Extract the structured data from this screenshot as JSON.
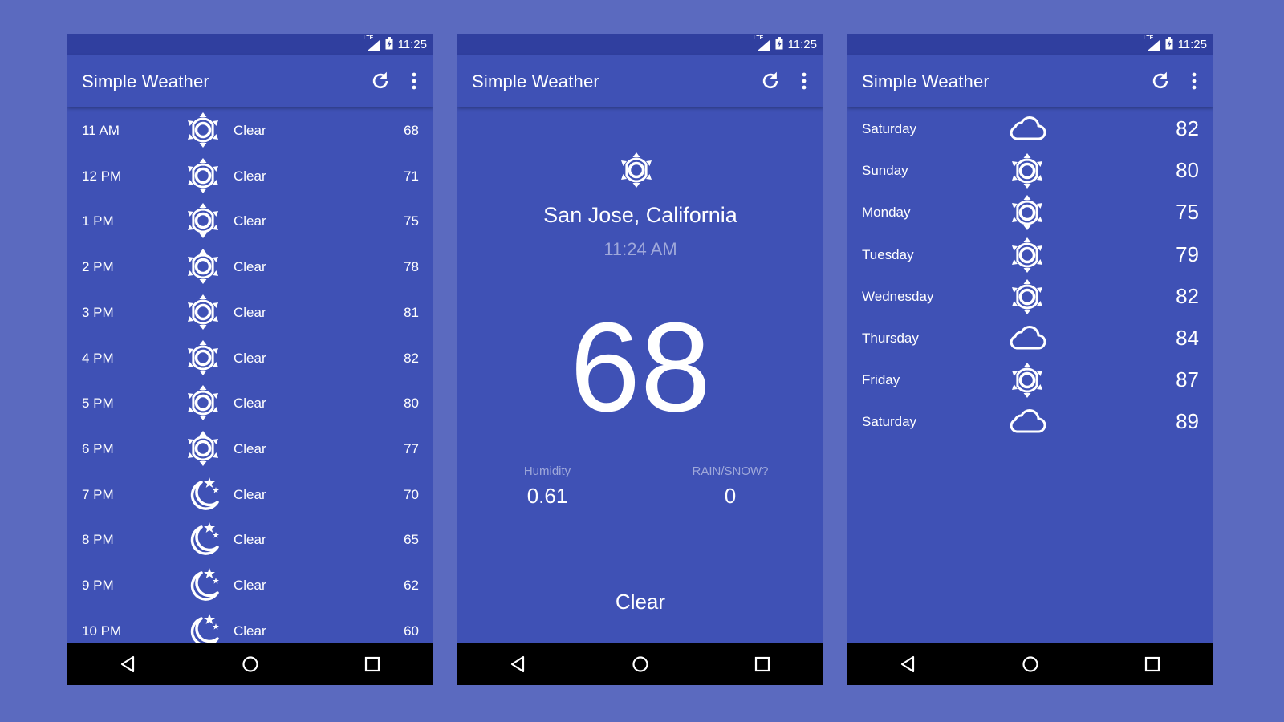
{
  "status_bar": {
    "network": "LTE",
    "time": "11:25"
  },
  "app": {
    "title": "Simple Weather"
  },
  "hourly": [
    {
      "time": "11 AM",
      "icon": "sun-icon",
      "condition": "Clear",
      "temp": "68"
    },
    {
      "time": "12 PM",
      "icon": "sun-icon",
      "condition": "Clear",
      "temp": "71"
    },
    {
      "time": "1 PM",
      "icon": "sun-icon",
      "condition": "Clear",
      "temp": "75"
    },
    {
      "time": "2 PM",
      "icon": "sun-icon",
      "condition": "Clear",
      "temp": "78"
    },
    {
      "time": "3 PM",
      "icon": "sun-icon",
      "condition": "Clear",
      "temp": "81"
    },
    {
      "time": "4 PM",
      "icon": "sun-icon",
      "condition": "Clear",
      "temp": "82"
    },
    {
      "time": "5 PM",
      "icon": "sun-icon",
      "condition": "Clear",
      "temp": "80"
    },
    {
      "time": "6 PM",
      "icon": "sun-icon",
      "condition": "Clear",
      "temp": "77"
    },
    {
      "time": "7 PM",
      "icon": "moon-stars-icon",
      "condition": "Clear",
      "temp": "70"
    },
    {
      "time": "8 PM",
      "icon": "moon-stars-icon",
      "condition": "Clear",
      "temp": "65"
    },
    {
      "time": "9 PM",
      "icon": "moon-stars-icon",
      "condition": "Clear",
      "temp": "62"
    },
    {
      "time": "10 PM",
      "icon": "moon-stars-icon",
      "condition": "Clear",
      "temp": "60"
    }
  ],
  "current": {
    "icon": "sun-icon",
    "location": "San Jose, California",
    "time": "11:24 AM",
    "temperature": "68",
    "humidity_label": "Humidity",
    "humidity_value": "0.61",
    "precip_label": "RAIN/SNOW?",
    "precip_value": "0",
    "summary": "Clear"
  },
  "daily": [
    {
      "day": "Saturday",
      "icon": "cloud-icon",
      "temp": "82"
    },
    {
      "day": "Sunday",
      "icon": "sun-icon",
      "temp": "80"
    },
    {
      "day": "Monday",
      "icon": "sun-icon",
      "temp": "75"
    },
    {
      "day": "Tuesday",
      "icon": "sun-icon",
      "temp": "79"
    },
    {
      "day": "Wednesday",
      "icon": "sun-icon",
      "temp": "82"
    },
    {
      "day": "Thursday",
      "icon": "cloud-icon",
      "temp": "84"
    },
    {
      "day": "Friday",
      "icon": "sun-icon",
      "temp": "87"
    },
    {
      "day": "Saturday",
      "icon": "cloud-icon",
      "temp": "89"
    }
  ],
  "colors": {
    "background": "#5b6abf",
    "primary": "#3f51b5",
    "primary_dark": "#303f9f",
    "secondary_text": "#9fa8da",
    "nav_bar": "#000000"
  }
}
